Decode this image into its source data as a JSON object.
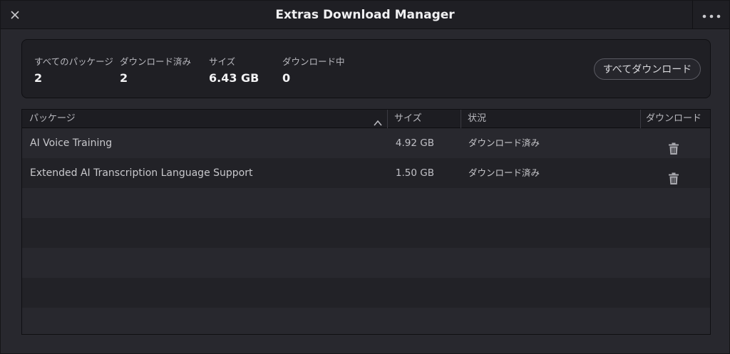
{
  "window": {
    "title": "Extras Download Manager"
  },
  "icons": {
    "close": "close-icon",
    "more": "more-horizontal-icon",
    "sort": "chevron-up-icon",
    "delete": "trash-icon"
  },
  "summary": {
    "all_packages_label": "すべてのパッケージ",
    "all_packages_value": "2",
    "downloaded_label": "ダウンロード済み",
    "downloaded_value": "2",
    "size_label": "サイズ",
    "size_value": "6.43 GB",
    "downloading_label": "ダウンロード中",
    "downloading_value": "0",
    "download_all_label": "すべてダウンロード"
  },
  "table": {
    "columns": {
      "package": "パッケージ",
      "size": "サイズ",
      "status": "状況",
      "download": "ダウンロード"
    },
    "rows": [
      {
        "name": "AI Voice Training",
        "size": "4.92 GB",
        "status": "ダウンロード済み"
      },
      {
        "name": "Extended AI Transcription Language Support",
        "size": "1.50 GB",
        "status": "ダウンロード済み"
      }
    ]
  },
  "colors": {
    "background": "#28282e",
    "panel": "#1f1f24",
    "row_alt": "#222227",
    "text": "#d8d8dc"
  }
}
